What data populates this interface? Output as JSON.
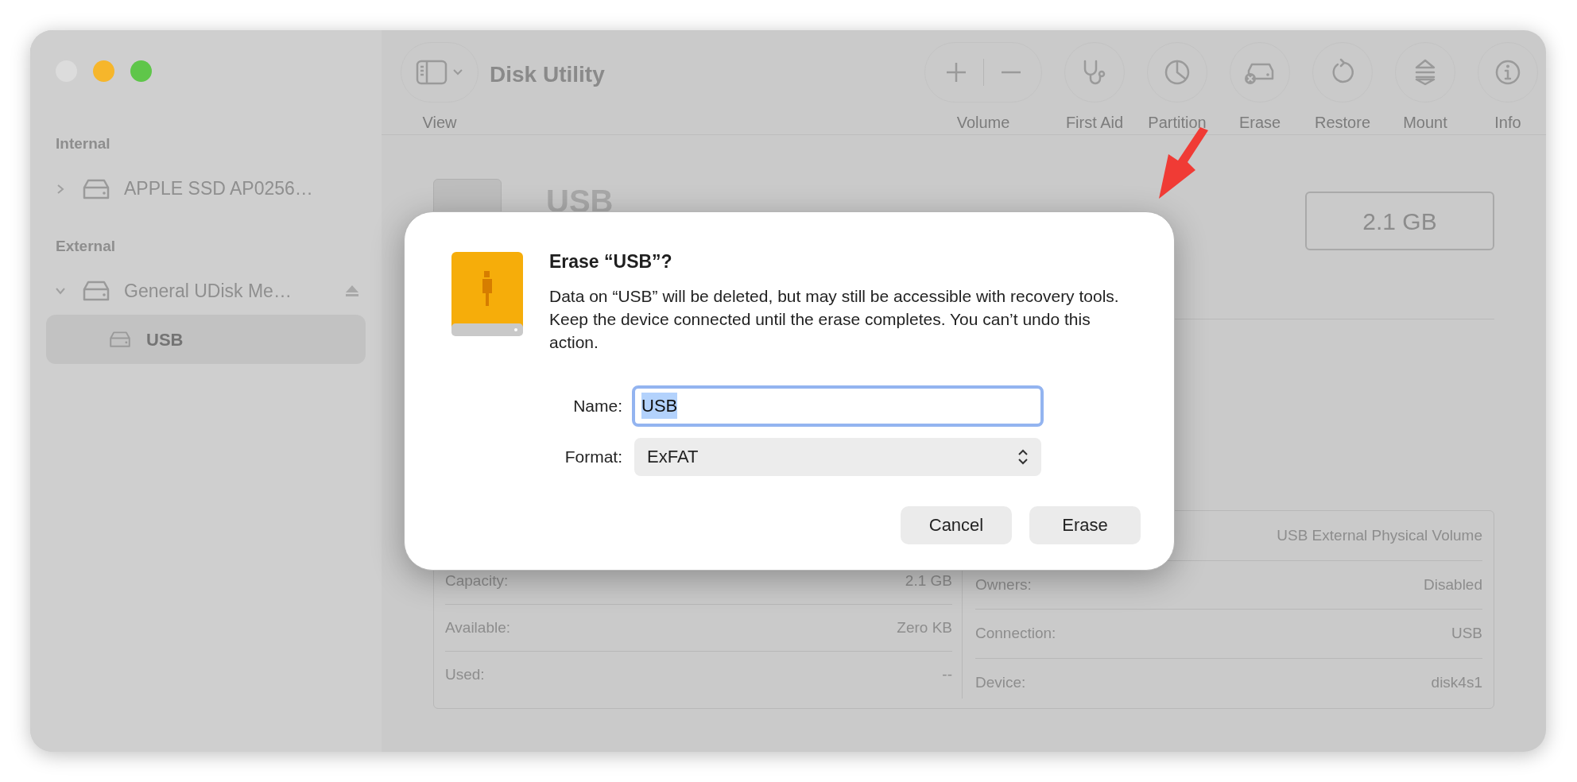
{
  "window": {
    "controls": [
      {
        "color": "#dcdcdc"
      },
      {
        "color": "#f6b62b"
      },
      {
        "color": "#5fc64a"
      }
    ]
  },
  "toolbar": {
    "view_button": {
      "label": "View"
    },
    "title": "Disk Utility",
    "actions": [
      {
        "kind": "volume",
        "label": "Volume"
      },
      {
        "kind": "first_aid",
        "label": "First Aid"
      },
      {
        "kind": "partition",
        "label": "Partition"
      },
      {
        "kind": "erase",
        "label": "Erase"
      },
      {
        "kind": "restore",
        "label": "Restore"
      },
      {
        "kind": "mount",
        "label": "Mount"
      },
      {
        "kind": "info",
        "label": "Info"
      }
    ]
  },
  "sidebar": {
    "sections": [
      {
        "heading": "Internal",
        "items": [
          {
            "label": "APPLE SSD AP0256…",
            "expanded": false,
            "selected": false,
            "eject": false
          }
        ]
      },
      {
        "heading": "External",
        "items": [
          {
            "label": "General UDisk Me…",
            "expanded": true,
            "selected": false,
            "eject": true,
            "children": [
              {
                "label": "USB",
                "selected": true
              }
            ]
          }
        ]
      }
    ]
  },
  "volume": {
    "name": "USB",
    "size": "2.1 GB"
  },
  "info": {
    "left": [
      {
        "label": "Capacity:",
        "value": "2.1 GB"
      },
      {
        "label": "Available:",
        "value": "Zero KB"
      },
      {
        "label": "Used:",
        "value": "--"
      }
    ],
    "right": [
      {
        "value": "USB External Physical Volume"
      },
      {
        "label": "Owners:",
        "value": "Disabled"
      },
      {
        "label": "Connection:",
        "value": "USB"
      },
      {
        "label": "Device:",
        "value": "disk4s1"
      }
    ]
  },
  "dialog": {
    "title": "Erase “USB”?",
    "message": "Data on “USB” will be deleted, but may still be accessible with recovery tools. Keep the device connected until the erase completes. You can’t undo this action.",
    "fields": [
      {
        "kind": "text",
        "label": "Name:",
        "value": "USB",
        "focused": true,
        "text_selected": true
      },
      {
        "kind": "select",
        "label": "Format:",
        "value": "ExFAT"
      }
    ],
    "buttons": [
      {
        "label": "Cancel"
      },
      {
        "label": "Erase"
      }
    ]
  }
}
